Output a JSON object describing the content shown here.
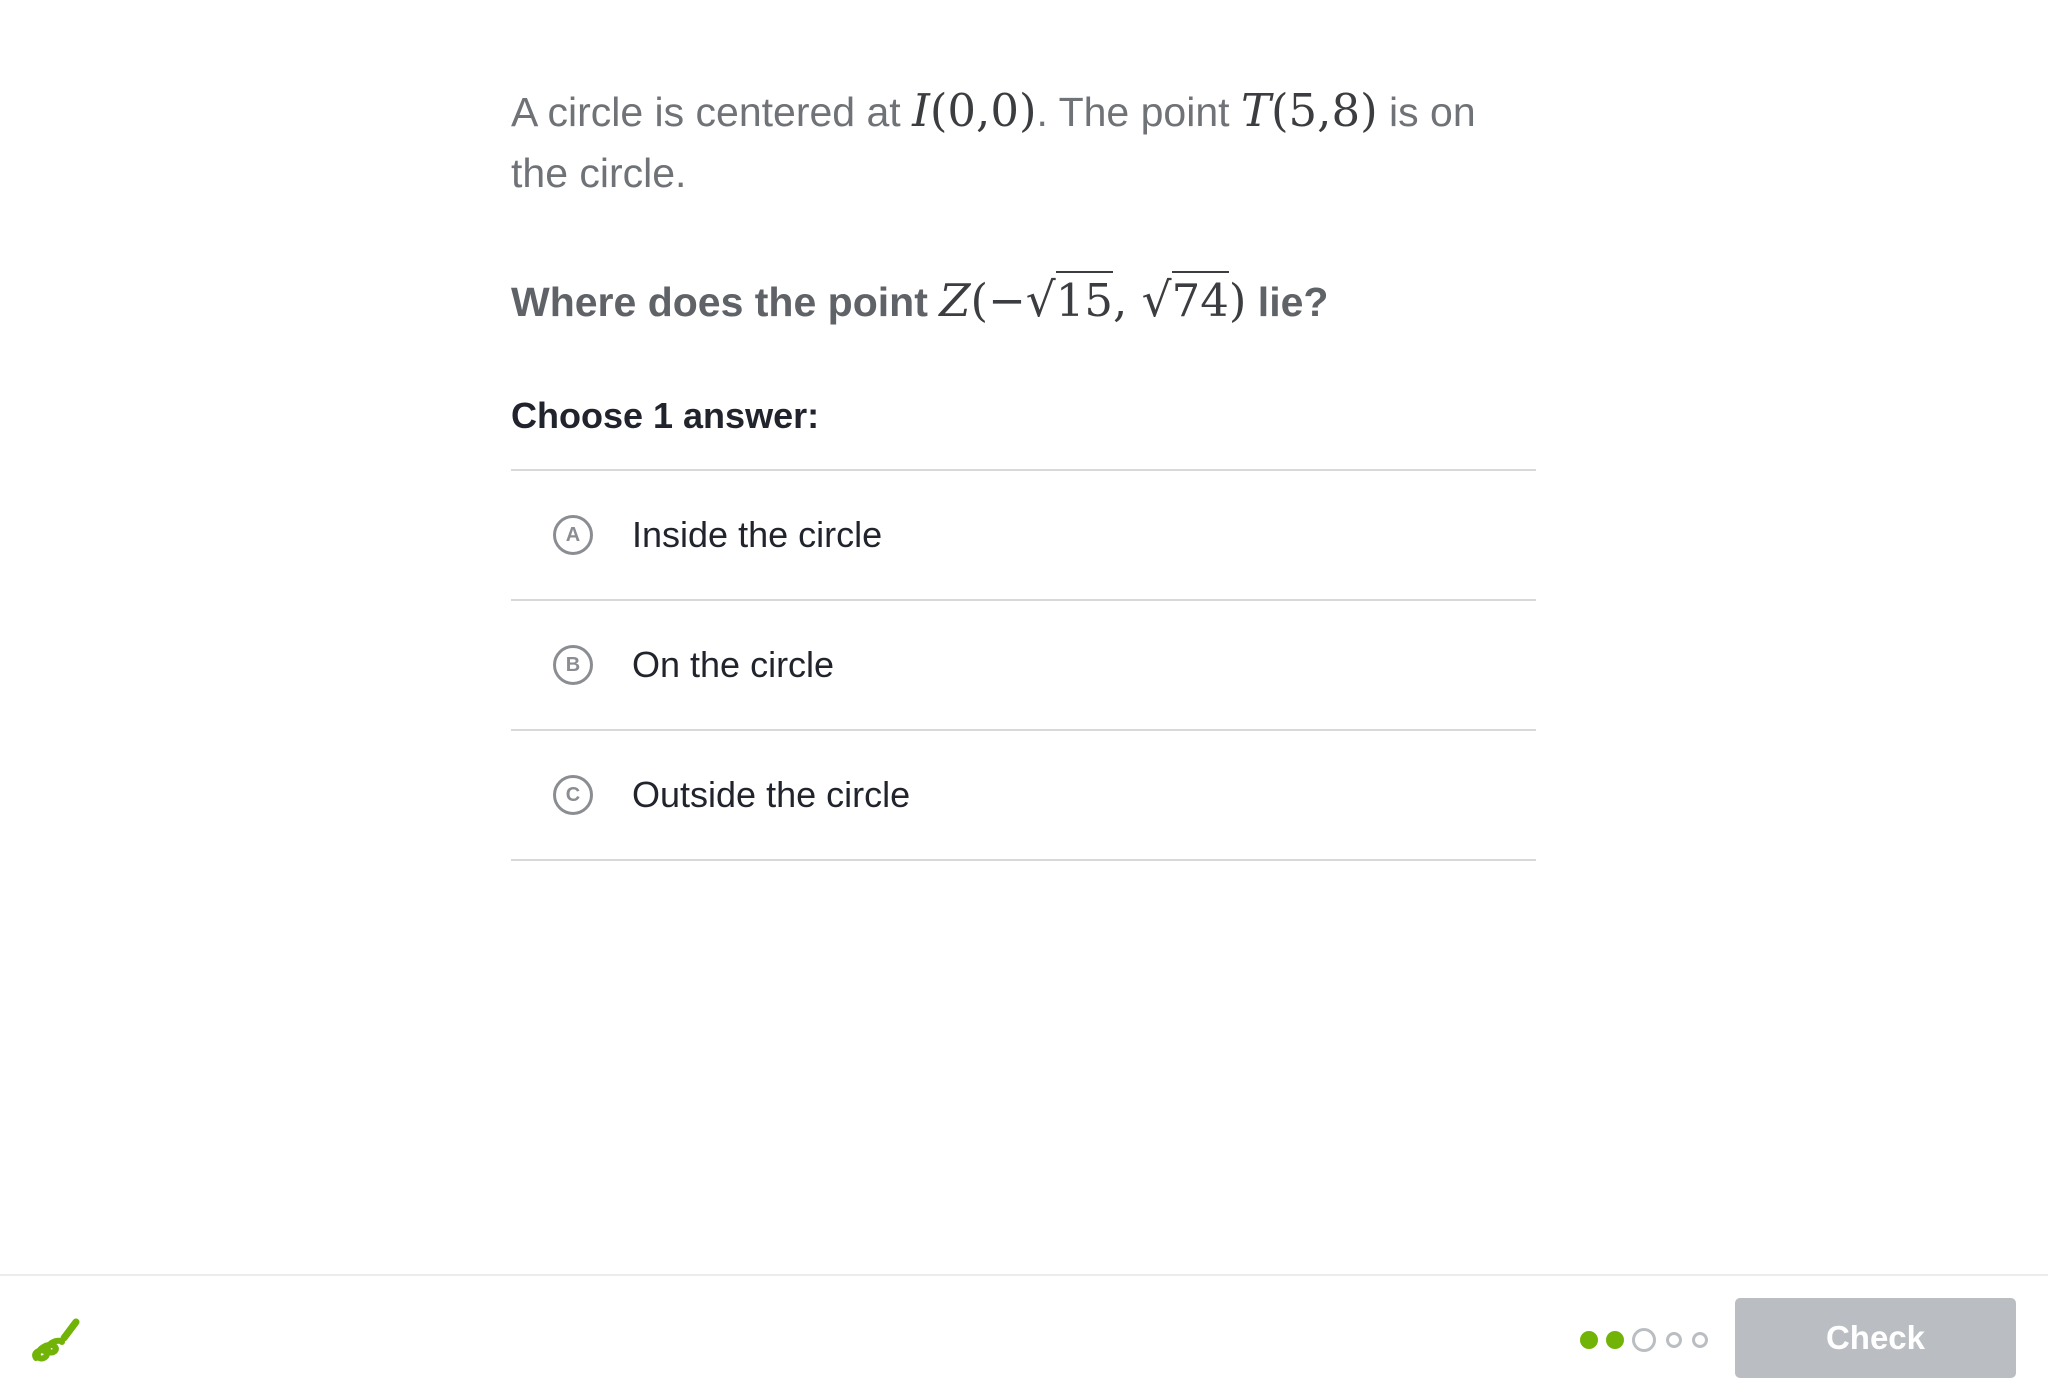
{
  "problem": {
    "text_1": "A circle is centered at ",
    "center_var": "I",
    "center_coords": "(0,0)",
    "text_2": ". The point ",
    "point_var": "T",
    "point_coords": "(5,8)",
    "text_3": " is on the circle."
  },
  "question": {
    "prefix": "Where does the point ",
    "point_var": "Z",
    "open": "(−",
    "radicand_x": "15",
    "comma": ", ",
    "radicand_y": "74",
    "close": ")",
    "suffix": " lie?"
  },
  "choose_label": "Choose 1 answer:",
  "choices": [
    {
      "letter": "A",
      "text": "Inside the circle"
    },
    {
      "letter": "B",
      "text": "On the circle"
    },
    {
      "letter": "C",
      "text": "Outside the circle"
    }
  ],
  "footer": {
    "logo_icon": "khan-academy-pen-icon",
    "progress": {
      "completed": 2,
      "current": 3,
      "total": 5
    },
    "check_label": "Check",
    "colors": {
      "accent": "#71b307",
      "disabled": "#babec2"
    }
  }
}
